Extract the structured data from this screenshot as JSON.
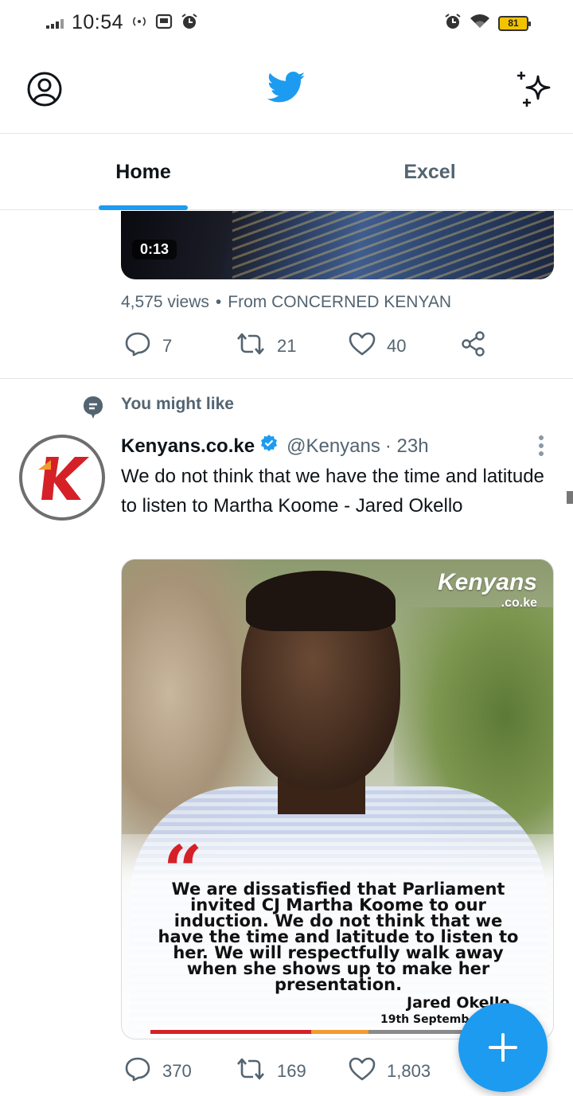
{
  "status_bar": {
    "time": "10:54",
    "battery": "81",
    "icons": [
      "signal-icon",
      "hotspot-icon",
      "inbox-icon",
      "alarm-icon",
      "alarm-icon",
      "wifi-icon",
      "battery-icon"
    ]
  },
  "header": {
    "icons": [
      "profile-icon",
      "twitter-bird-icon",
      "sparkle-icon"
    ],
    "accent": "#1d9bf0"
  },
  "tabs": [
    {
      "label": "Home",
      "active": true
    },
    {
      "label": "Excel",
      "active": false
    }
  ],
  "prev_tweet": {
    "video_duration": "0:13",
    "views": "4,575 views",
    "separator": "•",
    "source": "From CONCERNED KENYAN",
    "replies": "7",
    "retweets": "21",
    "likes": "40"
  },
  "suggestion": {
    "label": "You might like"
  },
  "tweet": {
    "name": "Kenyans.co.ke",
    "verified": true,
    "handle": "@Kenyans",
    "time": "· 23h",
    "text": "We do not think that we have the time and latitude to listen to Martha Koome - Jared Okello",
    "media": {
      "brand": "Kenyans",
      "brand_sub": ".co.ke",
      "quote": "We are dissatisfied that Parliament invited CJ Martha Koome to our induction. We do not think that we have the time and latitude to listen to her. We will respectfully walk away when she shows up to make her presentation.",
      "author": "Jared Okello",
      "date": "19th September"
    },
    "replies": "370",
    "retweets": "169",
    "likes": "1,803"
  },
  "colors": {
    "brand_red": "#d62027",
    "text_secondary": "#536471",
    "verified_blue": "#1d9bf0"
  }
}
